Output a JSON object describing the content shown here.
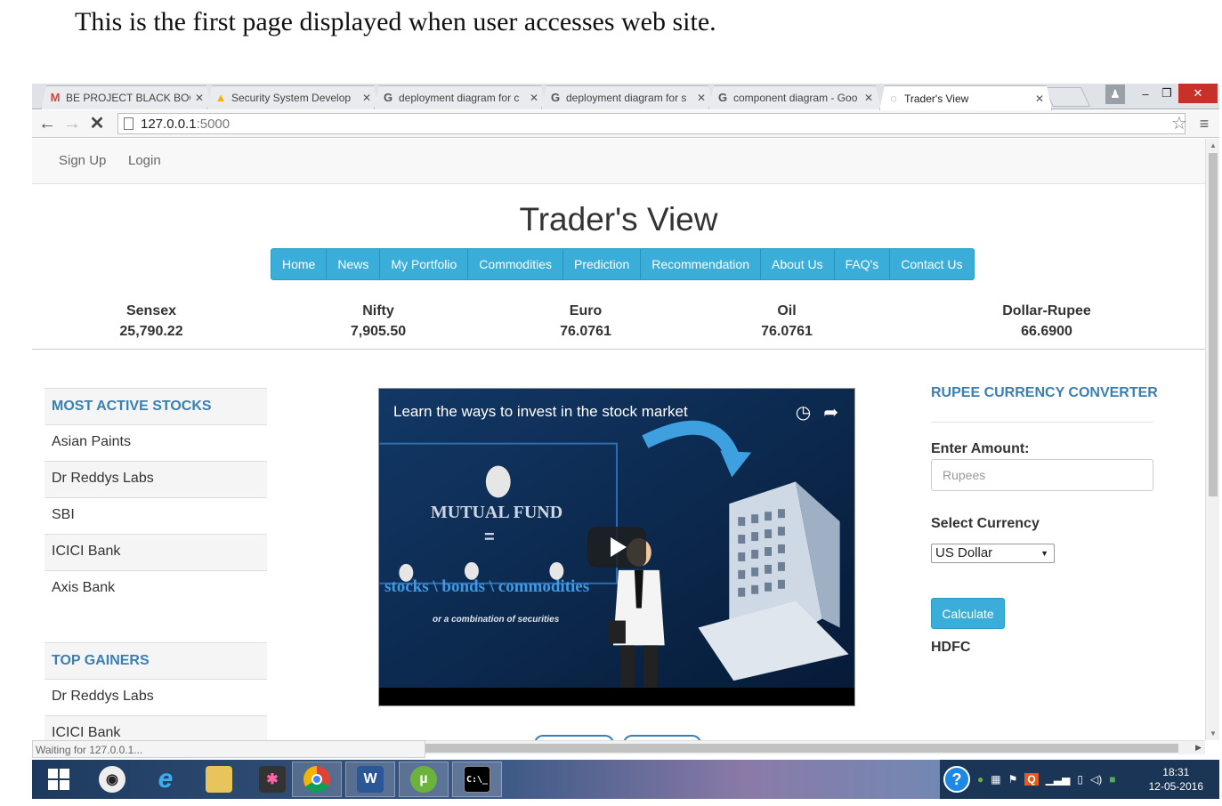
{
  "caption": "This is the first page displayed when user accesses web site.",
  "browser": {
    "tabs": [
      {
        "title": "BE PROJECT BLACK BOOK",
        "icon": "gmail-icon",
        "fav": "M",
        "fav_color": "#d44638"
      },
      {
        "title": "Security System Develop",
        "icon": "drive-icon",
        "fav": "▲",
        "fav_color": "#f4b400"
      },
      {
        "title": "deployment diagram for c",
        "icon": "google-icon",
        "fav": "G",
        "fav_color": "#555555"
      },
      {
        "title": "deployment diagram for s",
        "icon": "google-icon",
        "fav": "G",
        "fav_color": "#555555"
      },
      {
        "title": "component diagram - Goo",
        "icon": "google-icon",
        "fav": "G",
        "fav_color": "#555555"
      },
      {
        "title": "Trader's View",
        "icon": "loading-icon",
        "fav": "◌",
        "fav_color": "#777777",
        "active": true
      }
    ],
    "url_host": "127.0.0.1",
    "url_port": ":5000",
    "status_text": "Waiting for 127.0.0.1..."
  },
  "site": {
    "auth_links": {
      "signup": "Sign Up",
      "login": "Login"
    },
    "title": "Trader's View",
    "nav": [
      "Home",
      "News",
      "My Portfolio",
      "Commodities",
      "Prediction",
      "Recommendation",
      "About Us",
      "FAQ's",
      "Contact Us"
    ],
    "tickers": [
      {
        "name": "Sensex",
        "value": "25,790.22"
      },
      {
        "name": "Nifty",
        "value": "7,905.50"
      },
      {
        "name": "Euro",
        "value": "76.0761"
      },
      {
        "name": "Oil",
        "value": "76.0761"
      },
      {
        "name": "Dollar-Rupee",
        "value": "66.6900"
      }
    ],
    "most_active": {
      "heading": "MOST ACTIVE STOCKS",
      "items": [
        "Asian Paints",
        "Dr Reddys Labs",
        "SBI",
        "ICICI Bank",
        "Axis Bank"
      ]
    },
    "top_gainers": {
      "heading": "TOP GAINERS",
      "items": [
        "Dr Reddys Labs",
        "ICICI Bank"
      ]
    },
    "video": {
      "title": "Learn the ways to invest in the stock market",
      "mutual_fund": "MUTUAL FUND",
      "equals": "=",
      "assets": "stocks \\ bonds \\ commodities",
      "subtitle": "or a combination of securities"
    },
    "converter": {
      "heading": "RUPEE CURRENCY CONVERTER",
      "amount_label": "Enter Amount:",
      "amount_placeholder": "Rupees",
      "currency_label": "Select Currency",
      "currency_selected": "US Dollar",
      "calculate_label": "Calculate",
      "result": "HDFC"
    }
  },
  "taskbar": {
    "clock_time": "18:31",
    "clock_date": "12-05-2016"
  }
}
